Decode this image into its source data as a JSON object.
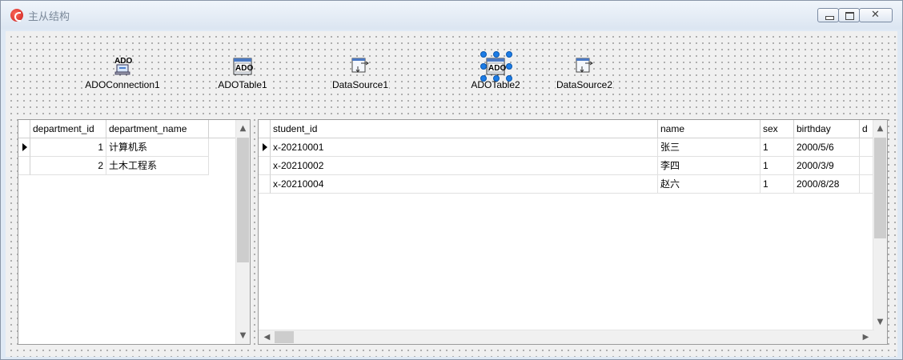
{
  "window": {
    "title": "主从结构",
    "controls": [
      "minimize-icon",
      "maximize-icon",
      "close-icon"
    ]
  },
  "components": [
    {
      "label": "ADOConnection1",
      "icon": "ado-connection-icon",
      "icon_text": "ADO",
      "selected": false
    },
    {
      "label": "ADOTable1",
      "icon": "ado-table-icon",
      "icon_text": "ADO",
      "selected": false
    },
    {
      "label": "DataSource1",
      "icon": "datasource-icon",
      "selected": false
    },
    {
      "label": "ADOTable2",
      "icon": "ado-table-icon",
      "icon_text": "ADO",
      "selected": true
    },
    {
      "label": "DataSource2",
      "icon": "datasource-icon",
      "selected": false
    }
  ],
  "master_grid": {
    "columns": [
      "department_id",
      "department_name"
    ],
    "rows": [
      {
        "department_id": "1",
        "department_name": "计算机系",
        "current": true
      },
      {
        "department_id": "2",
        "department_name": "土木工程系",
        "current": false
      }
    ]
  },
  "detail_grid": {
    "columns": [
      "student_id",
      "name",
      "sex",
      "birthday",
      "d"
    ],
    "rows": [
      {
        "student_id": "x-20210001",
        "name": "张三",
        "sex": "1",
        "birthday": "2000/5/6",
        "current": true
      },
      {
        "student_id": "x-20210002",
        "name": "李四",
        "sex": "1",
        "birthday": "2000/3/9",
        "current": false
      },
      {
        "student_id": "x-20210004",
        "name": "赵六",
        "sex": "1",
        "birthday": "2000/8/28",
        "current": false
      }
    ]
  },
  "colors": {
    "selection_handle": "#1c7ce6",
    "titlebar": "#dbe5f1",
    "form_background": "#f0f0f0"
  }
}
